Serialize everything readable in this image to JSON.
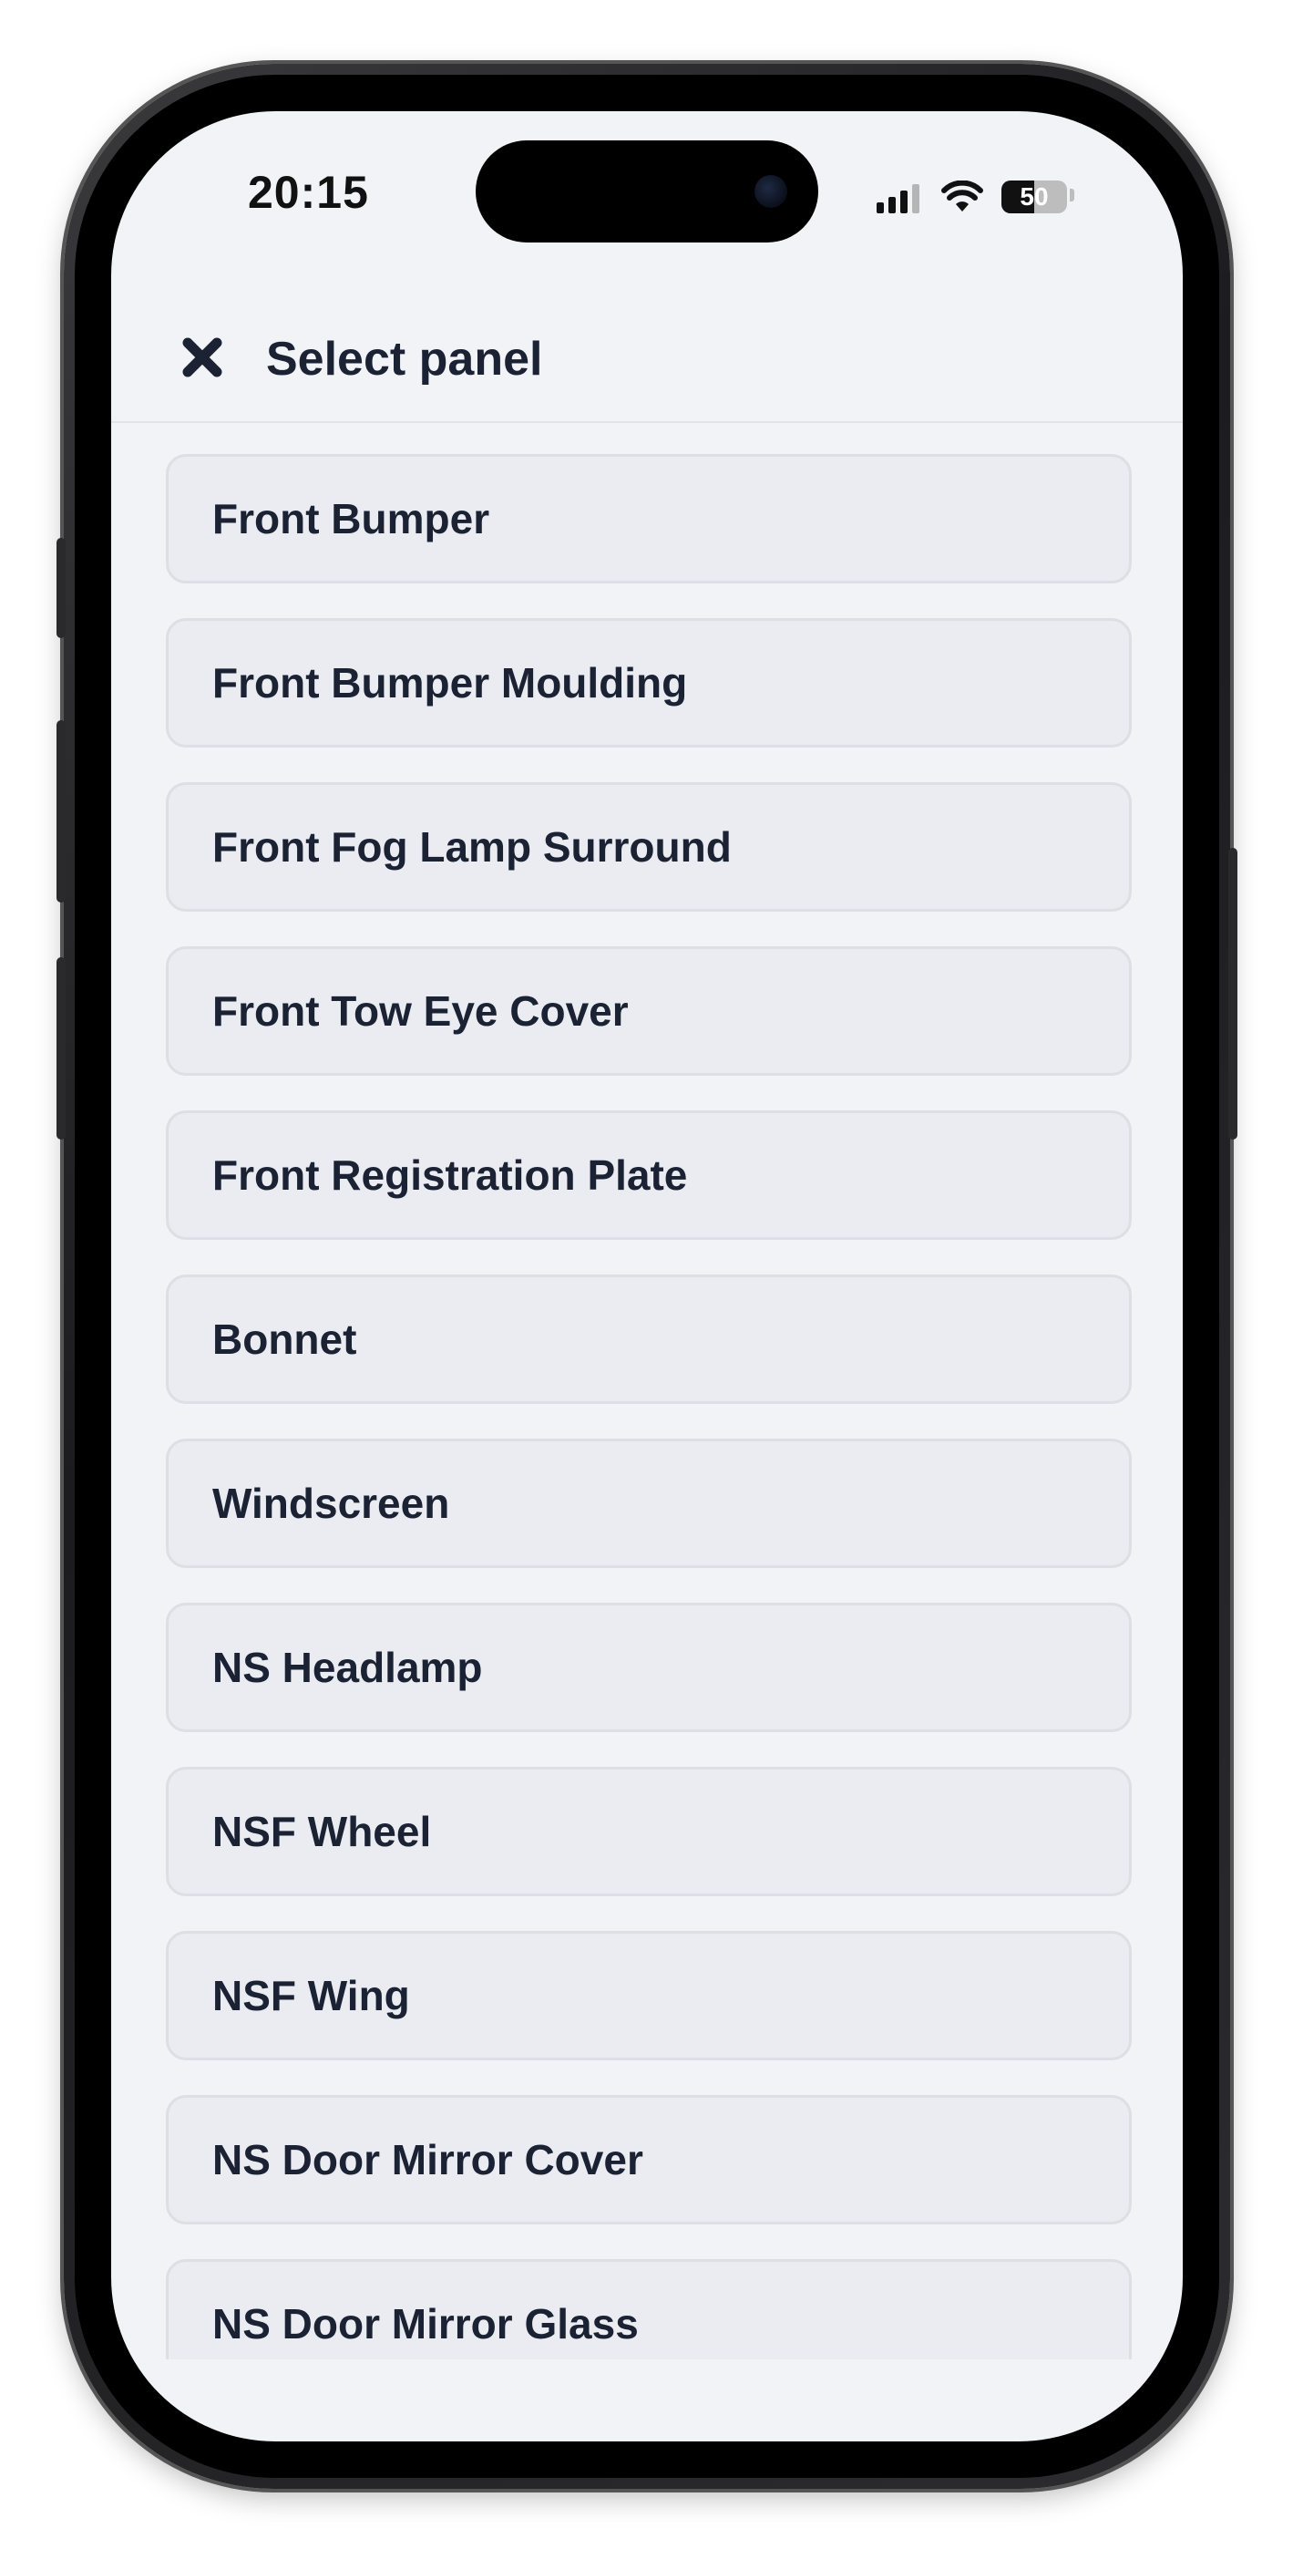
{
  "status_bar": {
    "time": "20:15",
    "battery_level": "50",
    "icons": [
      "cellular-signal-icon",
      "wifi-icon",
      "battery-icon"
    ]
  },
  "header": {
    "close_icon": "close-icon",
    "title": "Select panel"
  },
  "panels": [
    {
      "label": "Front Bumper"
    },
    {
      "label": "Front Bumper Moulding"
    },
    {
      "label": "Front Fog Lamp Surround"
    },
    {
      "label": "Front Tow Eye Cover"
    },
    {
      "label": "Front Registration Plate"
    },
    {
      "label": "Bonnet"
    },
    {
      "label": "Windscreen"
    },
    {
      "label": "NS Headlamp"
    },
    {
      "label": "NSF Wheel"
    },
    {
      "label": "NSF Wing"
    },
    {
      "label": "NS Door Mirror Cover"
    },
    {
      "label": "NS Door Mirror Glass"
    }
  ],
  "colors": {
    "screen_background": "#f2f3f6",
    "item_background": "#eaecf1",
    "item_border": "#dcdfe6",
    "text": "#1a2233"
  }
}
